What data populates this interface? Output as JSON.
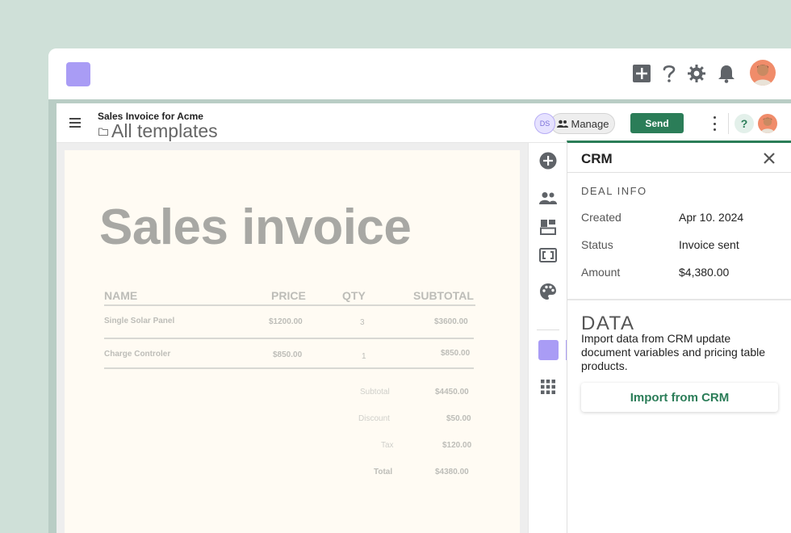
{
  "topbar": {
    "icons": [
      "plus-icon",
      "help-icon",
      "settings-icon",
      "bell-icon"
    ]
  },
  "header": {
    "doc_title": "Sales Invoice for Acme",
    "templates_link": "All templates",
    "ds_badge": "DS",
    "manage_label": "Manage",
    "send_label": "Send",
    "help_label": "?"
  },
  "invoice": {
    "title": "Sales invoice",
    "columns": [
      "NAME",
      "PRICE",
      "QTY",
      "SUBTOTAL"
    ],
    "rows": [
      {
        "name": "Single Solar Panel",
        "price": "$1200.00",
        "qty": "3",
        "subtotal": "$3600.00"
      },
      {
        "name": "Charge Controler",
        "price": "$850.00",
        "qty": "1",
        "subtotal": "$850.00"
      }
    ],
    "totals": [
      {
        "label": "Subtotal",
        "value": "$4450.00"
      },
      {
        "label": "Discount",
        "value": "$50.00"
      },
      {
        "label": "Tax",
        "value": "$120.00"
      },
      {
        "label": "Total",
        "value": "$4380.00"
      }
    ]
  },
  "toolrail": {
    "icons": [
      "add-block-icon",
      "recipients-icon",
      "layout-icon",
      "variables-icon",
      "design-icon",
      "crm-integration-icon",
      "apps-grid-icon"
    ]
  },
  "crm": {
    "title": "CRM",
    "deal_section": "DEAL INFO",
    "deal": [
      {
        "label": "Created",
        "value": "Apr 10. 2024"
      },
      {
        "label": "Status",
        "value": "Invoice sent"
      },
      {
        "label": "Amount",
        "value": "$4,380.00"
      }
    ],
    "data_title": "DATA",
    "data_description": "Import data from CRM update document variables and pricing table products.",
    "import_label": "Import from CRM"
  },
  "colors": {
    "accent_green": "#2b7d58",
    "accent_purple": "#a99cf5",
    "background": "#cfe0d8"
  }
}
